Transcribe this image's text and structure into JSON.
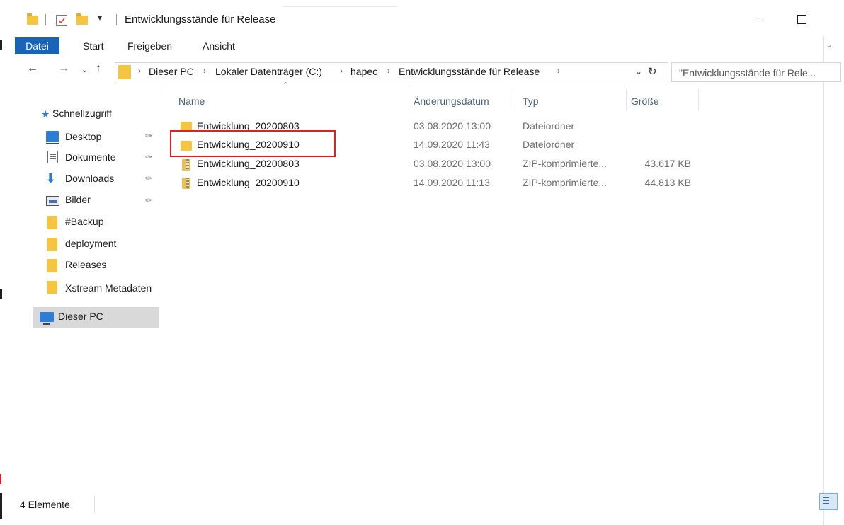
{
  "window": {
    "title": "Entwicklungsstände für Release",
    "quick_access_dropdown": "▾",
    "minimize_glyph": "—",
    "maximize_glyph": "☐"
  },
  "ribbon": {
    "tabs": [
      {
        "label": "Datei",
        "active": true
      },
      {
        "label": "Start"
      },
      {
        "label": "Freigeben"
      },
      {
        "label": "Ansicht"
      }
    ]
  },
  "address": {
    "breadcrumbs": [
      "Dieser PC",
      "Lokaler Datenträger (C:)",
      "hapec",
      "Entwicklungsstände für Release"
    ],
    "separator": "›",
    "search_placeholder": "\"Entwicklungsstände für Rele..."
  },
  "navigation": {
    "quick_access_label": "Schnellzugriff",
    "items": [
      {
        "label": "Desktop",
        "icon": "desktop-icon",
        "pinned": true
      },
      {
        "label": "Dokumente",
        "icon": "documents-icon",
        "pinned": true
      },
      {
        "label": "Downloads",
        "icon": "downloads-icon",
        "pinned": true
      },
      {
        "label": "Bilder",
        "icon": "pictures-icon",
        "pinned": true
      },
      {
        "label": "#Backup",
        "icon": "folder-icon"
      },
      {
        "label": "deployment",
        "icon": "folder-icon"
      },
      {
        "label": "Releases",
        "icon": "folder-icon"
      },
      {
        "label": "Xstream Metadaten",
        "icon": "folder-icon"
      }
    ],
    "this_pc_label": "Dieser PC"
  },
  "files": {
    "columns": [
      "Name",
      "Änderungsdatum",
      "Typ",
      "Größe"
    ],
    "rows": [
      {
        "name": "Entwicklung_20200803",
        "date": "03.08.2020 13:00",
        "type": "Dateiordner",
        "size": "",
        "icon": "folder-icon"
      },
      {
        "name": "Entwicklung_20200910",
        "date": "14.09.2020 11:43",
        "type": "Dateiordner",
        "size": "",
        "icon": "folder-icon",
        "highlighted": true
      },
      {
        "name": "Entwicklung_20200803",
        "date": "03.08.2020 13:00",
        "type": "ZIP-komprimierte...",
        "size": "43.617 KB",
        "icon": "zip-icon"
      },
      {
        "name": "Entwicklung_20200910",
        "date": "14.09.2020 11:13",
        "type": "ZIP-komprimierte...",
        "size": "44.813 KB",
        "icon": "zip-icon"
      }
    ]
  },
  "status": {
    "item_count": "4 Elemente"
  },
  "colors": {
    "accent": "#1a64b8",
    "highlight_border": "#e02020",
    "folder": "#f5c542"
  }
}
